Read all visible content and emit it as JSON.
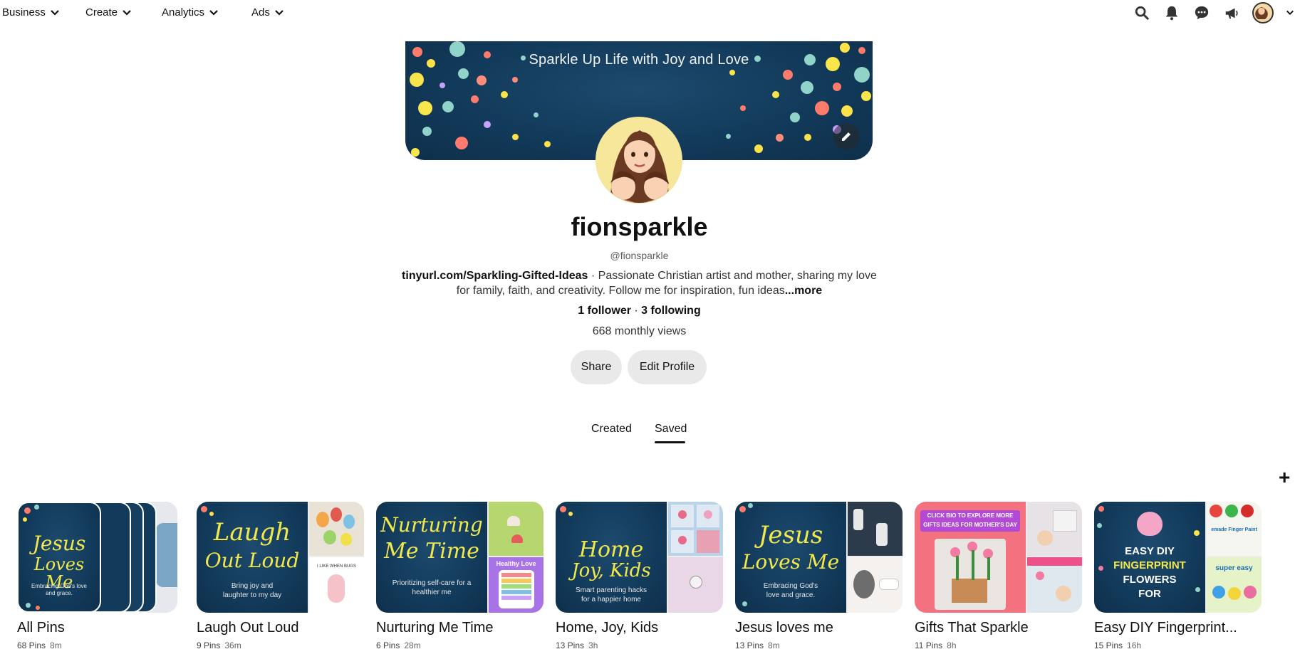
{
  "topnav": {
    "menus": [
      "Business",
      "Create",
      "Analytics",
      "Ads"
    ],
    "icons": [
      "search-icon",
      "notifications-icon",
      "messages-icon",
      "announcements-icon",
      "account-avatar",
      "chevron-down-icon"
    ]
  },
  "profile": {
    "cover_text": "Sparkle Up Life with Joy and Love",
    "name": "fionsparkle",
    "handle": "@fionsparkle",
    "bio_link": "tinyurl.com/Sparkling-Gifted-Ideas",
    "bio_separator": " · ",
    "bio_text": "Passionate Christian artist and mother, sharing my love for family, faith, and creativity. Follow me for inspiration, fun ideas",
    "bio_more": "...more",
    "followers": "1 follower",
    "follow_sep": " · ",
    "following": "3 following",
    "monthly_views": "668 monthly views",
    "share_label": "Share",
    "edit_label": "Edit Profile"
  },
  "tabs": {
    "created": "Created",
    "saved": "Saved",
    "active": "Saved"
  },
  "create_button": "+",
  "boards": [
    {
      "title": "All Pins",
      "pins": "68 Pins",
      "time": "8m",
      "cover_lines": [
        "Jesus",
        "Loves Me"
      ],
      "cover_sub": "Embracing God's love and grace."
    },
    {
      "title": "Laugh Out Loud",
      "pins": "9 Pins",
      "time": "36m",
      "cover_lines": [
        "Laugh",
        "Out Loud"
      ],
      "cover_sub": "Bring joy and laughter to my day"
    },
    {
      "title": "Nurturing Me Time",
      "pins": "6 Pins",
      "time": "28m",
      "cover_lines": [
        "Nurturing",
        "Me Time"
      ],
      "cover_sub": "Prioritizing self-care for a healthier me"
    },
    {
      "title": "Home, Joy, Kids",
      "pins": "13 Pins",
      "time": "3h",
      "cover_lines": [
        "Home",
        "Joy, Kids"
      ],
      "cover_sub": "Smart parenting hacks for a happier home"
    },
    {
      "title": "Jesus loves me",
      "pins": "13 Pins",
      "time": "8m",
      "cover_lines": [
        "Jesus",
        "Loves Me"
      ],
      "cover_sub": "Embracing God's love and grace."
    },
    {
      "title": "Gifts That Sparkle",
      "pins": "11 Pins",
      "time": "8h",
      "cover_lines": [
        "CLICK BIO TO EXPLORE MORE",
        "GIFTS IDEAS FOR MOTHER'S DAY"
      ],
      "cover_sub": ""
    },
    {
      "title": "Easy DIY Fingerprint...",
      "pins": "15 Pins",
      "time": "16h",
      "cover_lines": [
        "EASY DIY",
        "FINGERPRINT",
        "FLOWERS",
        "FOR"
      ],
      "cover_sub": ""
    }
  ],
  "board_side_texts": {
    "laugh": "I LIKE WHEN BUGS",
    "nurture": "Healthy Love",
    "easy_top": "emade Finger Paint",
    "easy_mid": "super easy"
  },
  "colors": {
    "accent_navy": "#123a5a",
    "script_yellow": "#f2e84b",
    "button_gray": "#e9e9e9"
  }
}
